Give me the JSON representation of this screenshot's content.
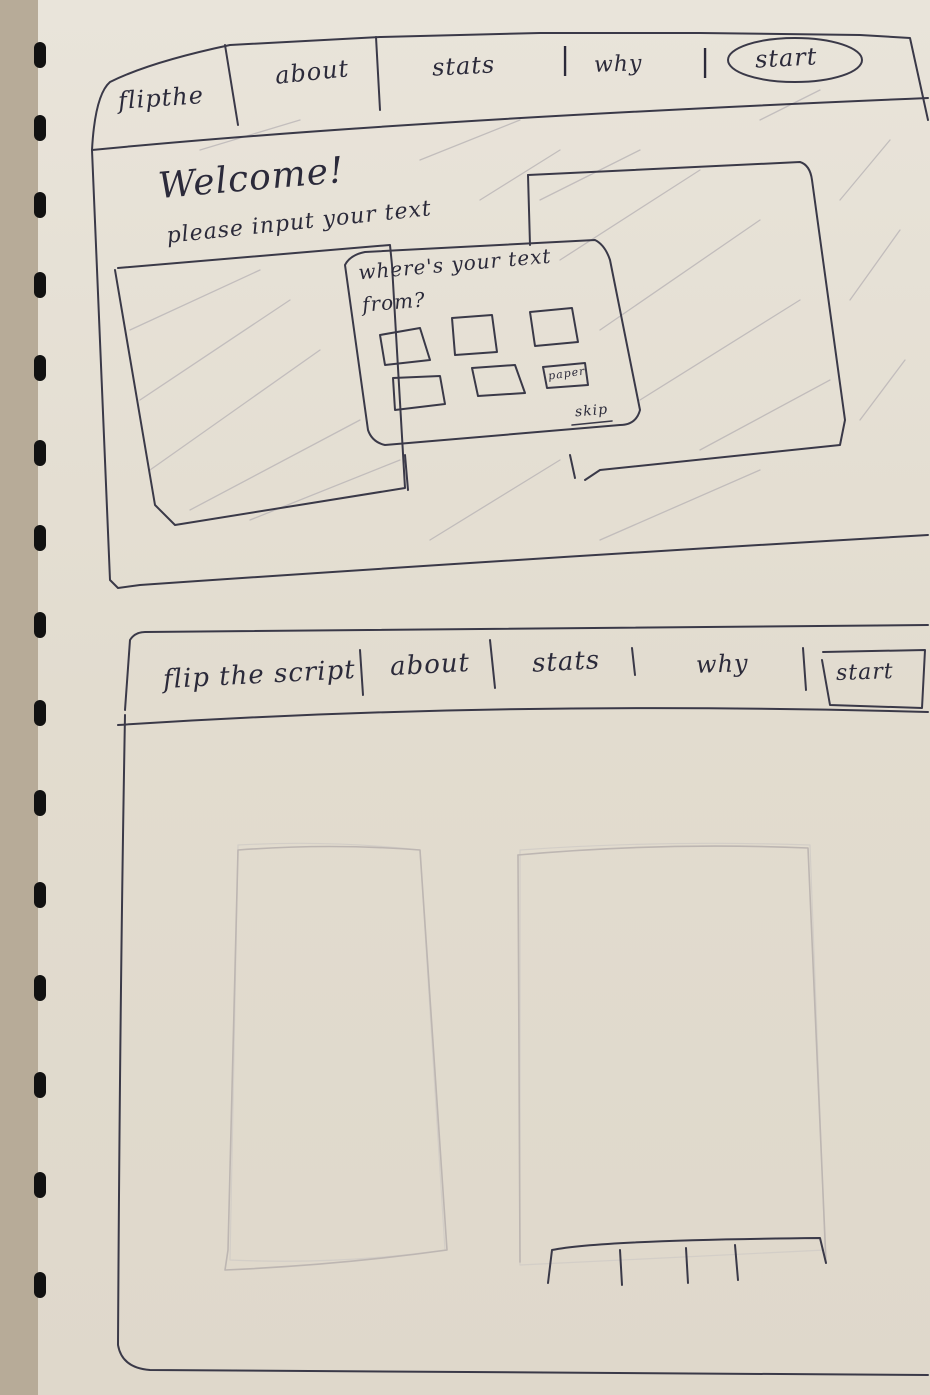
{
  "sketch1": {
    "nav": [
      "flipthe",
      "about",
      "stats",
      "why",
      "start"
    ],
    "welcome": "Welcome!",
    "prompt": "please input your text",
    "popup": {
      "question_line1": "where's your text",
      "question_line2": "from?",
      "paper_label": "paper",
      "skip_label": "skip"
    }
  },
  "sketch2": {
    "nav": [
      "flip the script",
      "about",
      "stats",
      "why",
      "start"
    ]
  }
}
